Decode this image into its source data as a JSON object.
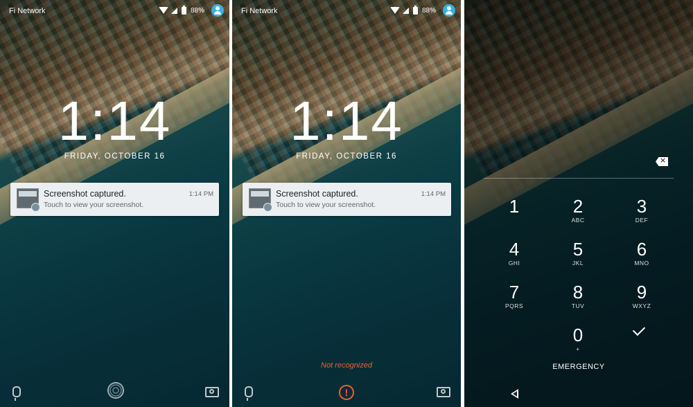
{
  "screens": [
    {
      "status": {
        "carrier": "Fi Network",
        "battery": "88%"
      },
      "clock": "1:14",
      "date": "FRIDAY, OCTOBER 16",
      "notification": {
        "title": "Screenshot captured.",
        "text": "Touch to view your screenshot.",
        "time": "1:14 PM"
      },
      "center_icon": "fingerprint-icon"
    },
    {
      "status": {
        "carrier": "Fi Network",
        "battery": "88%"
      },
      "clock": "1:14",
      "date": "FRIDAY, OCTOBER 16",
      "notification": {
        "title": "Screenshot captured.",
        "text": "Touch to view your screenshot.",
        "time": "1:14 PM"
      },
      "message": "Not recognized",
      "center_icon": "alert-icon",
      "alert_glyph": "!",
      "accent_color": "#e8622c"
    },
    {
      "pin_pad": {
        "keys": [
          {
            "digit": "1",
            "letters": ""
          },
          {
            "digit": "2",
            "letters": "ABC"
          },
          {
            "digit": "3",
            "letters": "DEF"
          },
          {
            "digit": "4",
            "letters": "GHI"
          },
          {
            "digit": "5",
            "letters": "JKL"
          },
          {
            "digit": "6",
            "letters": "MNO"
          },
          {
            "digit": "7",
            "letters": "PQRS"
          },
          {
            "digit": "8",
            "letters": "TUV"
          },
          {
            "digit": "9",
            "letters": "WXYZ"
          },
          {
            "digit": "0",
            "letters": "+"
          }
        ],
        "emergency_label": "EMERGENCY",
        "delete_glyph": "×"
      }
    }
  ]
}
